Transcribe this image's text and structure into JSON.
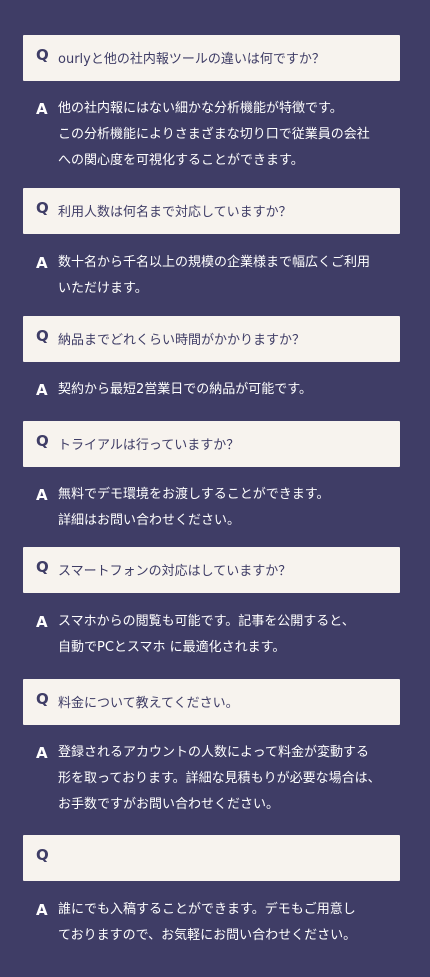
{
  "faq": [
    {
      "q_mark": "Q",
      "question": "ourlyと他の社内報ツールの違いは何ですか？",
      "a_mark": "A",
      "answer_lines": [
        "他の社内報にはない細かな分析機能が特徴です。",
        "この分析機能によりさまざまな切り口で従業員の会社",
        "への関心度を可視化することができます。"
      ]
    },
    {
      "q_mark": "Q",
      "question": "利用人数は何名まで対応していますか？",
      "a_mark": "A",
      "answer_lines": [
        "数十名から千名以上の規模の企業様まで幅広くご利用",
        "いただけます。"
      ]
    },
    {
      "q_mark": "Q",
      "question": "納品までどれくらい時間がかかりますか？",
      "a_mark": "A",
      "answer_lines": [
        "契約から最短2営業日での納品が可能です。"
      ]
    },
    {
      "q_mark": "Q",
      "question": "トライアルは行っていますか？",
      "a_mark": "A",
      "answer_lines": [
        "無料でデモ環境をお渡しすることができます。",
        "詳細はお問い合わせください。"
      ]
    },
    {
      "q_mark": "Q",
      "question": "スマートフォンの対応はしていますか？",
      "a_mark": "A",
      "answer_lines": [
        "スマホからの閲覧も可能です。記事を公開すると、",
        "自動でPCとスマホ に最適化されます。"
      ]
    },
    {
      "q_mark": "Q",
      "question": "料金について教えてください。",
      "a_mark": "A",
      "answer_lines": [
        "登録されるアカウントの人数によって料金が変動する",
        "形を取っております。詳細な見積もりが必要な場合は、",
        "お手数ですがお問い合わせください。"
      ]
    },
    {
      "q_mark": "Q",
      "question": "",
      "a_mark": "A",
      "answer_lines": [
        "誰にでも入稿することができます。デモもご用意し",
        "ておりますので、お気軽にお問い合わせください。"
      ]
    }
  ],
  "colors": {
    "background": "#3f3d66",
    "question_box": "#f7f3ee",
    "question_text": "#3f3d66",
    "answer_text": "#ffffff"
  }
}
